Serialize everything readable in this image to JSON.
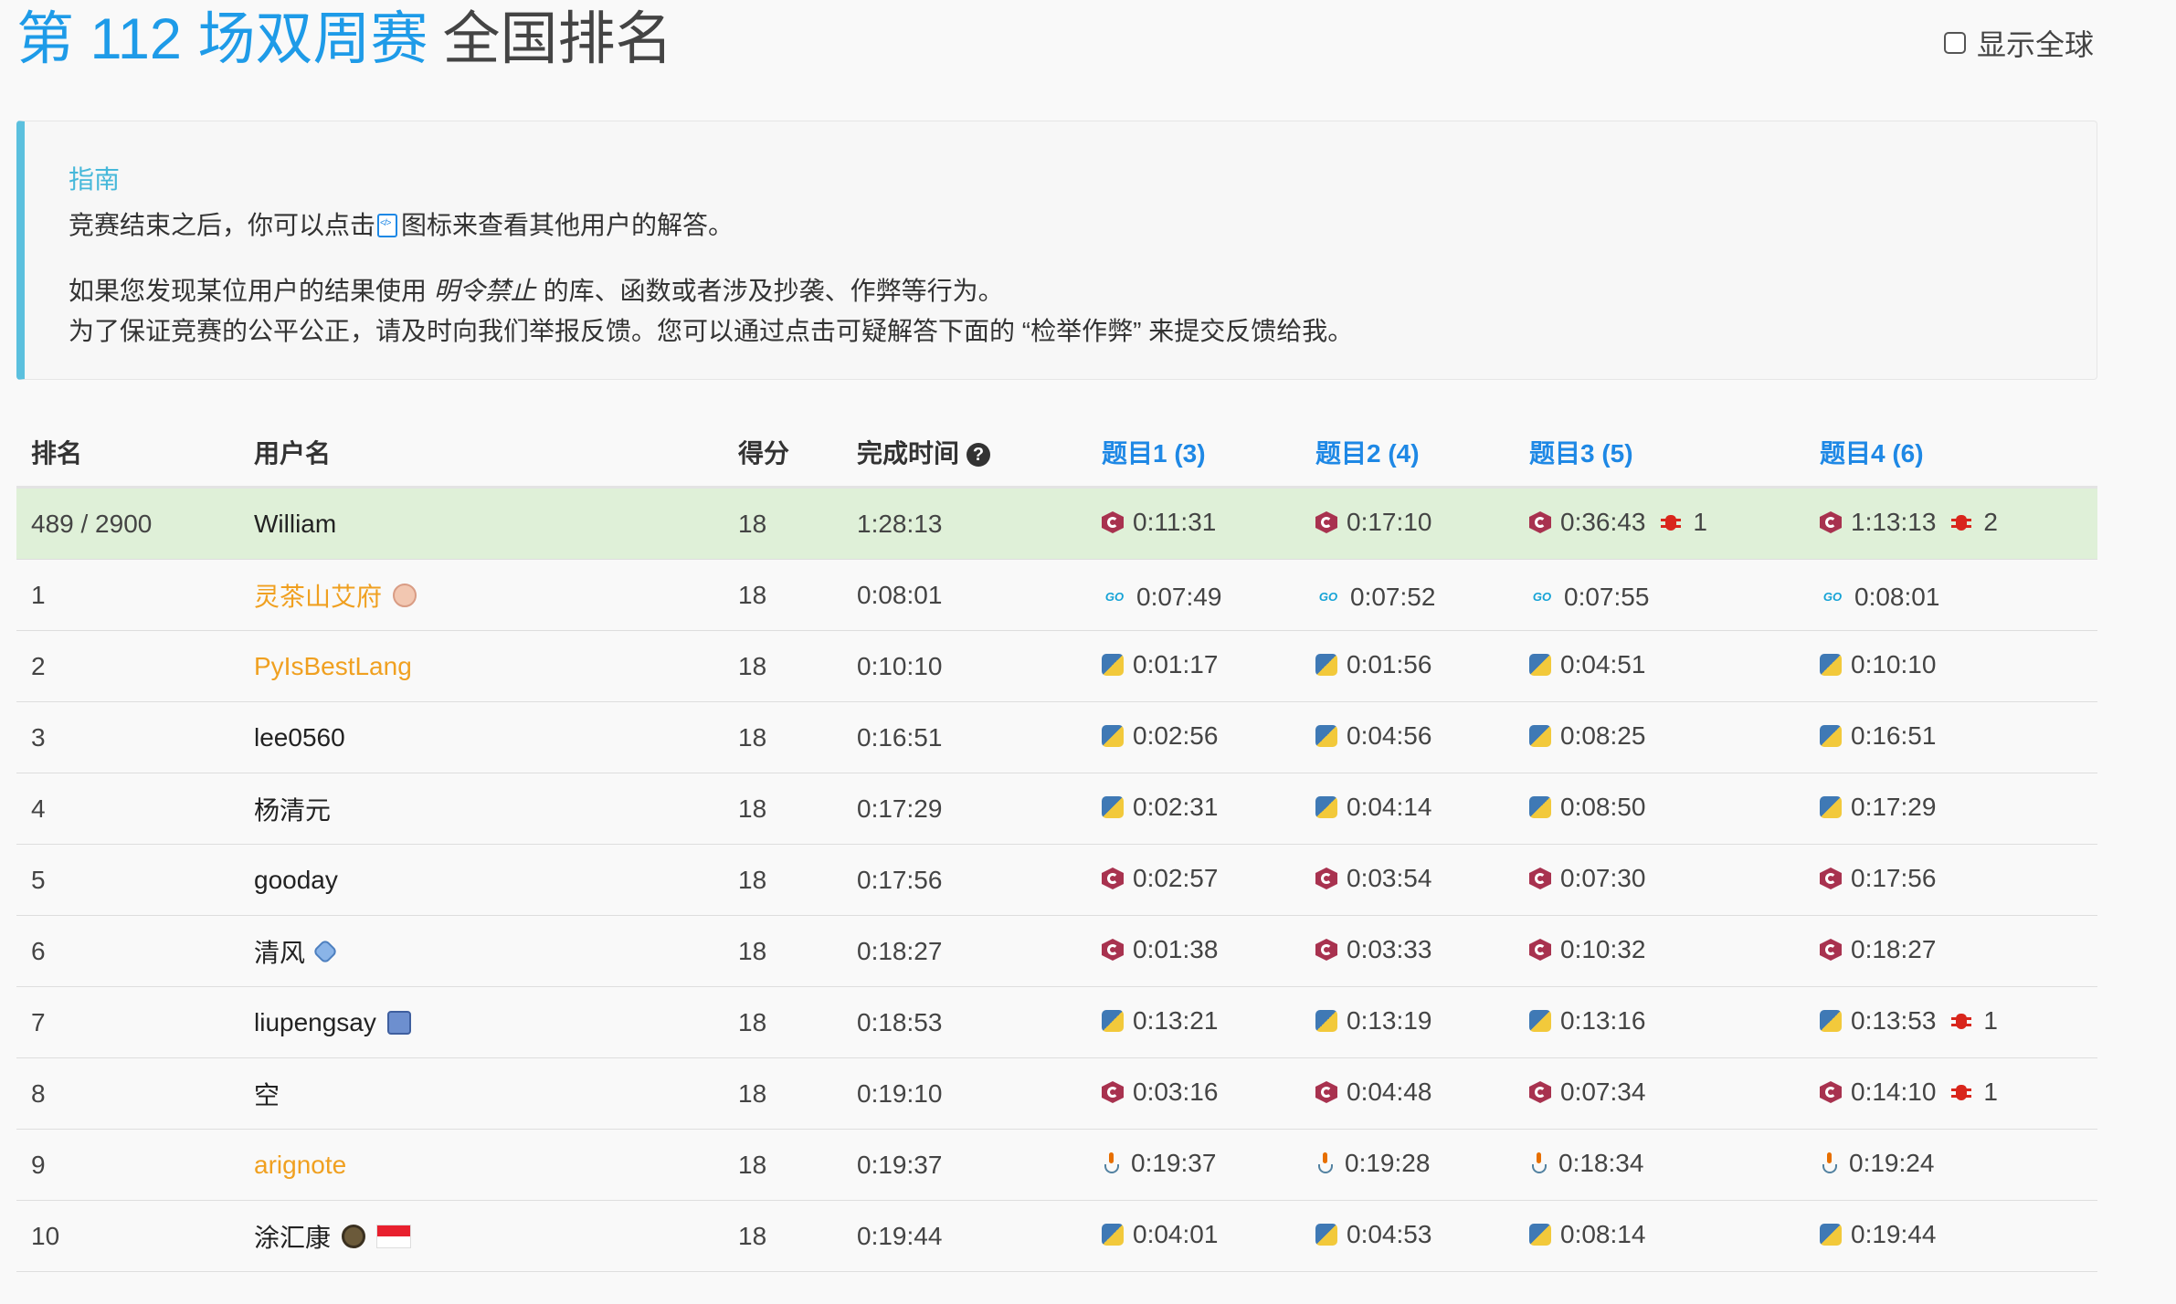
{
  "header": {
    "contest_name": "第 112 场双周赛",
    "title_suffix": "全国排名",
    "show_global_label": "显示全球"
  },
  "guide": {
    "title": "指南",
    "line1_before": "竞赛结束之后，你可以点击",
    "line1_after": "图标来查看其他用户的解答。",
    "line2_before": "如果您发现某位用户的结果使用",
    "line2_emphasis": "明令禁止",
    "line2_after": "的库、函数或者涉及抄袭、作弊等行为。",
    "line3": "为了保证竞赛的公平公正，请及时向我们举报反馈。您可以通过点击可疑解答下面的 “检举作弊” 来提交反馈给我。"
  },
  "table": {
    "headers": {
      "rank": "排名",
      "user": "用户名",
      "score": "得分",
      "finish_time": "完成时间",
      "q1": "题目1 (3)",
      "q2": "题目2 (4)",
      "q3": "题目3 (5)",
      "q4": "题目4 (6)"
    },
    "rows": [
      {
        "rank": "489 / 2900",
        "user": "William",
        "score": "18",
        "finish": "1:28:13",
        "lang": "cpp",
        "highlight": true,
        "q": [
          {
            "t": "0:11:31"
          },
          {
            "t": "0:17:10"
          },
          {
            "t": "0:36:43",
            "bugs": "1"
          },
          {
            "t": "1:13:13",
            "bugs": "2"
          }
        ]
      },
      {
        "rank": "1",
        "user": "灵茶山艾府",
        "score": "18",
        "finish": "0:08:01",
        "lang": "go",
        "user_color": "orange",
        "badge": "peach",
        "q": [
          {
            "t": "0:07:49"
          },
          {
            "t": "0:07:52"
          },
          {
            "t": "0:07:55"
          },
          {
            "t": "0:08:01"
          }
        ]
      },
      {
        "rank": "2",
        "user": "PyIsBestLang",
        "score": "18",
        "finish": "0:10:10",
        "lang": "py",
        "user_color": "orange",
        "q": [
          {
            "t": "0:01:17"
          },
          {
            "t": "0:01:56"
          },
          {
            "t": "0:04:51"
          },
          {
            "t": "0:10:10"
          }
        ]
      },
      {
        "rank": "3",
        "user": "lee0560",
        "score": "18",
        "finish": "0:16:51",
        "lang": "py",
        "q": [
          {
            "t": "0:02:56"
          },
          {
            "t": "0:04:56"
          },
          {
            "t": "0:08:25"
          },
          {
            "t": "0:16:51"
          }
        ]
      },
      {
        "rank": "4",
        "user": "杨清元",
        "score": "18",
        "finish": "0:17:29",
        "lang": "py",
        "q": [
          {
            "t": "0:02:31"
          },
          {
            "t": "0:04:14"
          },
          {
            "t": "0:08:50"
          },
          {
            "t": "0:17:29"
          }
        ]
      },
      {
        "rank": "5",
        "user": "gooday",
        "score": "18",
        "finish": "0:17:56",
        "lang": "cpp",
        "q": [
          {
            "t": "0:02:57"
          },
          {
            "t": "0:03:54"
          },
          {
            "t": "0:07:30"
          },
          {
            "t": "0:17:56"
          }
        ]
      },
      {
        "rank": "6",
        "user": "清风",
        "score": "18",
        "finish": "0:18:27",
        "lang": "cpp",
        "badge": "blue",
        "q": [
          {
            "t": "0:01:38"
          },
          {
            "t": "0:03:33"
          },
          {
            "t": "0:10:32"
          },
          {
            "t": "0:18:27"
          }
        ]
      },
      {
        "rank": "7",
        "user": "liupengsay",
        "score": "18",
        "finish": "0:18:53",
        "lang": "py",
        "badge": "cube",
        "q": [
          {
            "t": "0:13:21"
          },
          {
            "t": "0:13:19"
          },
          {
            "t": "0:13:16"
          },
          {
            "t": "0:13:53",
            "bugs": "1"
          }
        ]
      },
      {
        "rank": "8",
        "user": "空",
        "score": "18",
        "finish": "0:19:10",
        "lang": "cpp",
        "q": [
          {
            "t": "0:03:16"
          },
          {
            "t": "0:04:48"
          },
          {
            "t": "0:07:34"
          },
          {
            "t": "0:14:10",
            "bugs": "1"
          }
        ]
      },
      {
        "rank": "9",
        "user": "arignote",
        "score": "18",
        "finish": "0:19:37",
        "lang": "java",
        "user_color": "orange",
        "q": [
          {
            "t": "0:19:37"
          },
          {
            "t": "0:19:28"
          },
          {
            "t": "0:18:34"
          },
          {
            "t": "0:19:24"
          }
        ]
      },
      {
        "rank": "10",
        "user": "涂汇康",
        "score": "18",
        "finish": "0:19:44",
        "lang": "py",
        "badge": "dark",
        "flag": "sg",
        "q": [
          {
            "t": "0:04:01"
          },
          {
            "t": "0:04:53"
          },
          {
            "t": "0:08:14"
          },
          {
            "t": "0:19:44"
          }
        ]
      }
    ]
  },
  "icons": {
    "help": "question-circle-icon",
    "view_solution": "view-code-icon",
    "bug": "bug-icon",
    "languages": [
      "cpp-icon",
      "python-icon",
      "go-icon",
      "java-icon"
    ]
  },
  "colors": {
    "accent": "#1e9be8",
    "link_blue": "#1e88e5",
    "guide_border": "#5bc0de",
    "highlight_row": "#dff0d8",
    "orange_user": "#f0a020",
    "bug_red": "#d9261c",
    "cpp": "#a8324f"
  }
}
